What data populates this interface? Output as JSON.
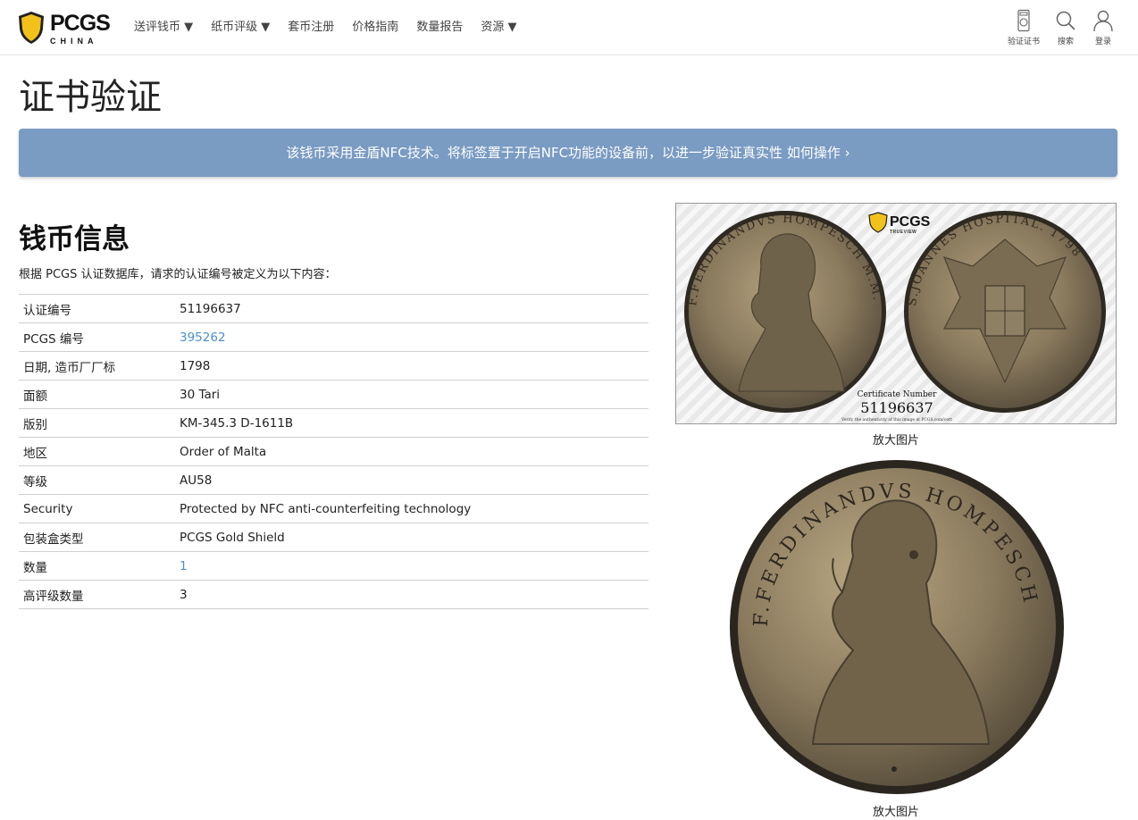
{
  "header": {
    "logo_text": "PCGS",
    "logo_sub": "CHINA",
    "nav": [
      "送评钱币 ▼",
      "纸币评级 ▼",
      "套币注册",
      "价格指南",
      "数量报告",
      "资源 ▼"
    ],
    "tools": {
      "verify": "验证证书",
      "search": "搜索",
      "login": "登录"
    }
  },
  "page_title": "证书验证",
  "banner": "该钱币采用金盾NFC技术。将标签置于开启NFC功能的设备前，以进一步验证真实性 如何操作 ›",
  "coin_info": {
    "title": "钱币信息",
    "subtitle": "根据 PCGS 认证数据库，请求的认证编号被定义为以下内容：",
    "rows": [
      {
        "label": "认证编号",
        "value": "51196637"
      },
      {
        "label": "PCGS 编号",
        "value": "395262"
      },
      {
        "label": "日期, 造币厂厂标",
        "value": "1798"
      },
      {
        "label": "面额",
        "value": "30 Tari"
      },
      {
        "label": "版别",
        "value": "KM-345.3 D-1611B"
      },
      {
        "label": "地区",
        "value": "Order of Malta"
      },
      {
        "label": "等级",
        "value": "AU58"
      },
      {
        "label": "Security",
        "value": "Protected by NFC anti-counterfeiting technology"
      },
      {
        "label": "包装盒类型",
        "value": "PCGS Gold Shield"
      },
      {
        "label": "数量",
        "value": "1"
      },
      {
        "label": "高评级数量",
        "value": "3"
      }
    ]
  },
  "images": {
    "trueview_brand": "PCGS",
    "trueview_sub": "TRUEVIEW",
    "cert_label": "Certificate Number",
    "cert_number": "51196637",
    "verify_note": "Verify the authenticity of this image at PCGS.com/cert",
    "enlarge_1": "放大图片",
    "enlarge_2": "放大图片",
    "obverse_legend": "F.FERDINANDVS HOMPESCH M.M.",
    "reverse_legend": "S.JOANNES HOSPITAL. 1798",
    "colors": {
      "toning": "#8a7a5e",
      "rim": "#3b352a"
    }
  },
  "colors": {
    "banner": "#7a9bc2",
    "link": "#4a8fd0",
    "shield": "#f2c21b"
  }
}
